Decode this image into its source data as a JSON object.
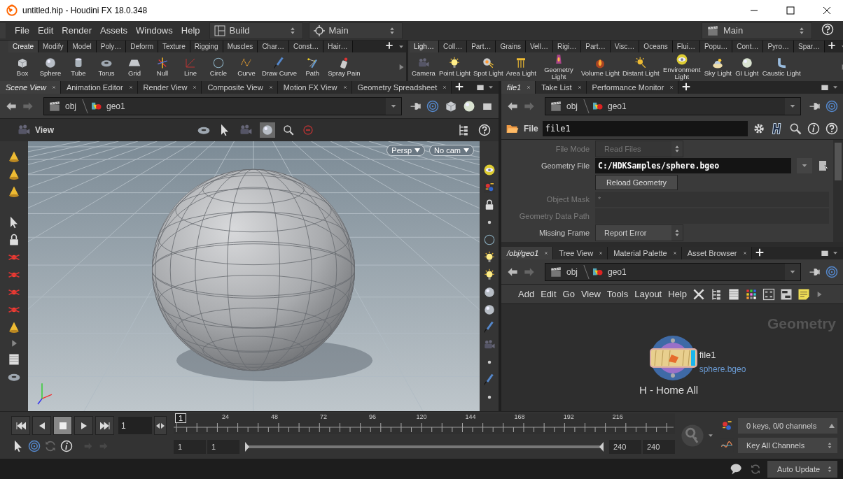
{
  "window": {
    "title": "untitled.hip - Houdini FX 18.0.348"
  },
  "menu_bar": {
    "menus": [
      "File",
      "Edit",
      "Render",
      "Assets",
      "Windows",
      "Help"
    ],
    "desktop": "Build",
    "context": "Main",
    "take": "Main"
  },
  "shelves": [
    {
      "tabs": [
        {
          "label": "Create",
          "selected": true
        },
        {
          "label": "Modify",
          "selected": false
        },
        {
          "label": "Model",
          "selected": false
        },
        {
          "label": "Poly…",
          "selected": false
        },
        {
          "label": "Deform",
          "selected": false
        },
        {
          "label": "Texture",
          "selected": false
        },
        {
          "label": "Rigging",
          "selected": false
        },
        {
          "label": "Muscles",
          "selected": false
        },
        {
          "label": "Char…",
          "selected": false
        },
        {
          "label": "Const…",
          "selected": false
        },
        {
          "label": "Hair…",
          "selected": false
        }
      ],
      "tools": [
        "Box",
        "Sphere",
        "Tube",
        "Torus",
        "Grid",
        "Null",
        "Line",
        "Circle",
        "Curve",
        "Draw Curve",
        "Path",
        "Spray Pain"
      ]
    },
    {
      "tabs": [
        {
          "label": "Ligh…",
          "selected": true
        },
        {
          "label": "Coll…",
          "selected": false
        },
        {
          "label": "Part…",
          "selected": false
        },
        {
          "label": "Grains",
          "selected": false
        },
        {
          "label": "Vell…",
          "selected": false
        },
        {
          "label": "Rigi…",
          "selected": false
        },
        {
          "label": "Part…",
          "selected": false
        },
        {
          "label": "Visc…",
          "selected": false
        },
        {
          "label": "Oceans",
          "selected": false
        },
        {
          "label": "Flui…",
          "selected": false
        },
        {
          "label": "Popu…",
          "selected": false
        },
        {
          "label": "Cont…",
          "selected": false
        },
        {
          "label": "Pyro…",
          "selected": false
        },
        {
          "label": "Spar…",
          "selected": false
        }
      ],
      "tools": [
        "Camera",
        "Point Light",
        "Spot Light",
        "Area Light",
        "Geometry Light",
        "Volume Light",
        "Distant Light",
        "Environment Light",
        "Sky Light",
        "GI Light",
        "Caustic Light"
      ]
    }
  ],
  "scene_pane": {
    "tabs": [
      {
        "label": "Scene View",
        "selected": true
      },
      {
        "label": "Animation Editor",
        "selected": false
      },
      {
        "label": "Render View",
        "selected": false
      },
      {
        "label": "Composite View",
        "selected": false
      },
      {
        "label": "Motion FX View",
        "selected": false
      },
      {
        "label": "Geometry Spreadsheet",
        "selected": false
      }
    ],
    "path": [
      "obj",
      "geo1"
    ],
    "toolbar_title": "View",
    "camera_menus": [
      "Persp",
      "No cam"
    ]
  },
  "param_pane": {
    "tabs": [
      {
        "label": "file1",
        "selected": true
      },
      {
        "label": "Take List",
        "selected": false
      },
      {
        "label": "Performance Monitor",
        "selected": false
      }
    ],
    "path": [
      "obj",
      "geo1"
    ],
    "node_type": "File",
    "node_name": "file1",
    "parms": [
      {
        "kind": "menu",
        "label": "File Mode",
        "value": "Read Files",
        "disabled": true
      },
      {
        "kind": "file",
        "label": "Geometry File",
        "value": "C:/HDKSamples/sphere.bgeo",
        "disabled": false
      },
      {
        "kind": "button",
        "label": "Reload Geometry",
        "disabled": false
      },
      {
        "kind": "text",
        "label": "Object Mask",
        "value": "*",
        "disabled": true
      },
      {
        "kind": "text",
        "label": "Geometry Data Path",
        "disabled": true
      },
      {
        "kind": "menu",
        "label": "Missing Frame",
        "value": "Report Error",
        "disabled": false
      }
    ]
  },
  "network_pane": {
    "tabs": [
      {
        "label": "/obj/geo1",
        "selected": true
      },
      {
        "label": "Tree View",
        "selected": false
      },
      {
        "label": "Material Palette",
        "selected": false
      },
      {
        "label": "Asset Browser",
        "selected": false
      }
    ],
    "path": [
      "obj",
      "geo1"
    ],
    "menus": [
      "Add",
      "Edit",
      "Go",
      "View",
      "Tools",
      "Layout",
      "Help"
    ],
    "context_label": "Geometry",
    "node": {
      "name": "file1",
      "file": "sphere.bgeo"
    },
    "hint": "H - Home All"
  },
  "timeline": {
    "frame": "1",
    "current_marker": "1",
    "ruler_labels": [
      "24",
      "48",
      "72",
      "96",
      "120",
      "144",
      "168",
      "192",
      "216"
    ],
    "range": [
      "1",
      "1",
      "240",
      "240"
    ],
    "range_slider": {
      "level": 1
    },
    "keys_status": "0 keys, 0/0 channels",
    "key_menu": "Key All Channels"
  },
  "status_bar": {
    "update_mode": "Auto Update"
  }
}
